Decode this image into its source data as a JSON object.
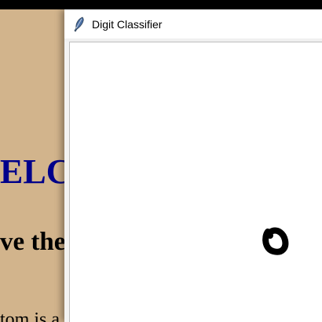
{
  "background_page": {
    "heading_1": "ELC",
    "heading_2": "ve the",
    "paragraph": "tom is a"
  },
  "window": {
    "title": "Digit Classifier",
    "icon": "feather-icon"
  },
  "canvas": {
    "drawing": "digit-0-stroke"
  },
  "colors": {
    "background_page": "#d2b48c",
    "heading_1": "#00008b",
    "canvas": "#ffffff",
    "stroke": "#000000"
  }
}
